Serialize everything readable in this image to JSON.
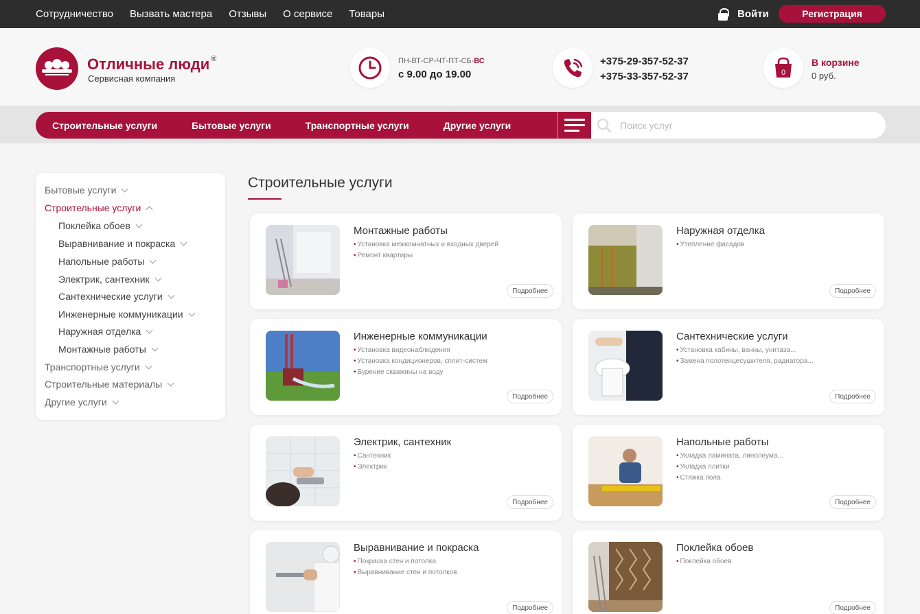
{
  "topnav": [
    "Сотрудничество",
    "Вызвать мастера",
    "Отзывы",
    "О сервисе",
    "Товары"
  ],
  "login_label": "Войти",
  "register_label": "Регистрация",
  "brand": {
    "name": "Отличные люди",
    "reg_mark": "®",
    "subtitle": "Сервисная компания"
  },
  "schedule": {
    "days": "ПН-ВТ-СР-ЧТ-ПТ-СБ-",
    "day_highlight": "ВС",
    "hours": "с 9.00 до 19.00"
  },
  "phones": [
    "+375-29-357-52-37",
    "+375-33-357-52-37"
  ],
  "cart": {
    "title": "В корзине",
    "sum": "0 руб.",
    "count": "0"
  },
  "mainnav": [
    "Строительные услуги",
    "Бытовые услуги",
    "Транспортные услуги",
    "Другие услуги"
  ],
  "search_placeholder": "Поиск услуг",
  "sidebar": [
    {
      "label": "Бытовые услуги",
      "level": 0,
      "state": "collapsed"
    },
    {
      "label": "Строительные услуги",
      "level": 0,
      "state": "expanded"
    },
    {
      "label": "Поклейка обоев",
      "level": 1,
      "state": "collapsed"
    },
    {
      "label": "Выравнивание и покраска",
      "level": 1,
      "state": "collapsed"
    },
    {
      "label": "Напольные работы",
      "level": 1,
      "state": "collapsed"
    },
    {
      "label": "Электрик, сантехник",
      "level": 1,
      "state": "collapsed"
    },
    {
      "label": "Сантехнические услуги",
      "level": 1,
      "state": "collapsed"
    },
    {
      "label": "Инженерные коммуникации",
      "level": 1,
      "state": "collapsed"
    },
    {
      "label": "Наружная отделка",
      "level": 1,
      "state": "collapsed"
    },
    {
      "label": "Монтажные работы",
      "level": 1,
      "state": "collapsed"
    },
    {
      "label": "Транспортные услуги",
      "level": 0,
      "state": "collapsed"
    },
    {
      "label": "Строительные материалы",
      "level": 0,
      "state": "collapsed"
    },
    {
      "label": "Другие услуги",
      "level": 0,
      "state": "collapsed"
    }
  ],
  "page_title": "Строительные услуги",
  "more_label": "Подробнее",
  "cards": [
    {
      "title": "Монтажные работы",
      "items": [
        "Установка межкомнатных и входных дверей",
        "Ремонт квартиры"
      ]
    },
    {
      "title": "Наружная отделка",
      "items": [
        "Утепление фасадов"
      ]
    },
    {
      "title": "Инженерные коммуникации",
      "items": [
        "Установка видеонаблюдения",
        "Установка кондиционеров, сплит-систем",
        "Бурение скважины на воду"
      ]
    },
    {
      "title": "Сантехнические услуги",
      "items": [
        "Установка кабины, ванны, унитаза...",
        "Замена полотенцесушителя, радиатора..."
      ]
    },
    {
      "title": "Электрик, сантехник",
      "items": [
        "Сантехник",
        "Электрик"
      ]
    },
    {
      "title": "Напольные работы",
      "items": [
        "Укладка ламината, линолеума...",
        "Укладка плитки",
        "Стяжка пола"
      ]
    },
    {
      "title": "Выравнивание и покраска",
      "items": [
        "Покраска стен и потолка",
        "Выравнивание стен и потолков"
      ]
    },
    {
      "title": "Поклейка обоев",
      "items": [
        "Поклейка обоев"
      ]
    }
  ],
  "colors": {
    "accent": "#a8123a",
    "topbar": "#2d2d2d",
    "background": "#f5f5f5"
  }
}
